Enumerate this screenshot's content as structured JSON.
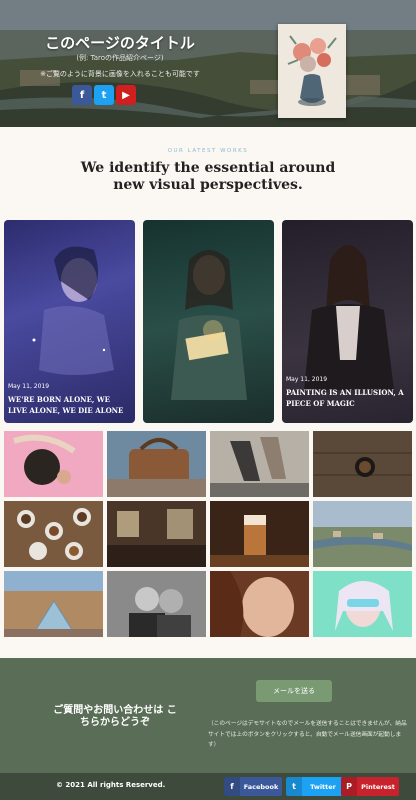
{
  "hero": {
    "title": "このページのタイトル",
    "subtitle": "(例: Taroの作品紹介ページ)",
    "description": "※ご覧のように背景に画像を入れることも可能です",
    "social": [
      {
        "name": "facebook",
        "glyph": "f",
        "color": "#3b5998"
      },
      {
        "name": "twitter",
        "glyph": "t",
        "color": "#1da1f2"
      },
      {
        "name": "youtube",
        "glyph": "▶",
        "color": "#cd201f"
      }
    ]
  },
  "works": {
    "label": "OUR LATEST WORKS",
    "title": "We identify the essential around new visual perspectives."
  },
  "cards": [
    {
      "date": "May 11, 2019",
      "title": "WE'RE BORN ALONE, WE LIVE ALONE, WE DIE ALONE"
    },
    {
      "date": "",
      "title": ""
    },
    {
      "date": "May 11, 2019",
      "title": "PAINTING IS AN ILLUSION, A PIECE OF MAGIC"
    }
  ],
  "contact": {
    "title": "ご質問やお問い合わせは こちらからどうぞ",
    "button": "メールを送る",
    "note": "（このページはデモサイトなのでメールを送信することはできませんが、納品サイトでは上のボタンをクリックすると、自動でメール送信画面が起動します）"
  },
  "footer": {
    "copyright": "© 2021 All rights Reserved.",
    "buttons": [
      {
        "label": "Facebook",
        "glyph": "f",
        "color": "#3b5998"
      },
      {
        "label": "Twitter",
        "glyph": "t",
        "color": "#1da1f2"
      },
      {
        "label": "Pinterest",
        "glyph": "P",
        "color": "#c8232c"
      }
    ]
  }
}
